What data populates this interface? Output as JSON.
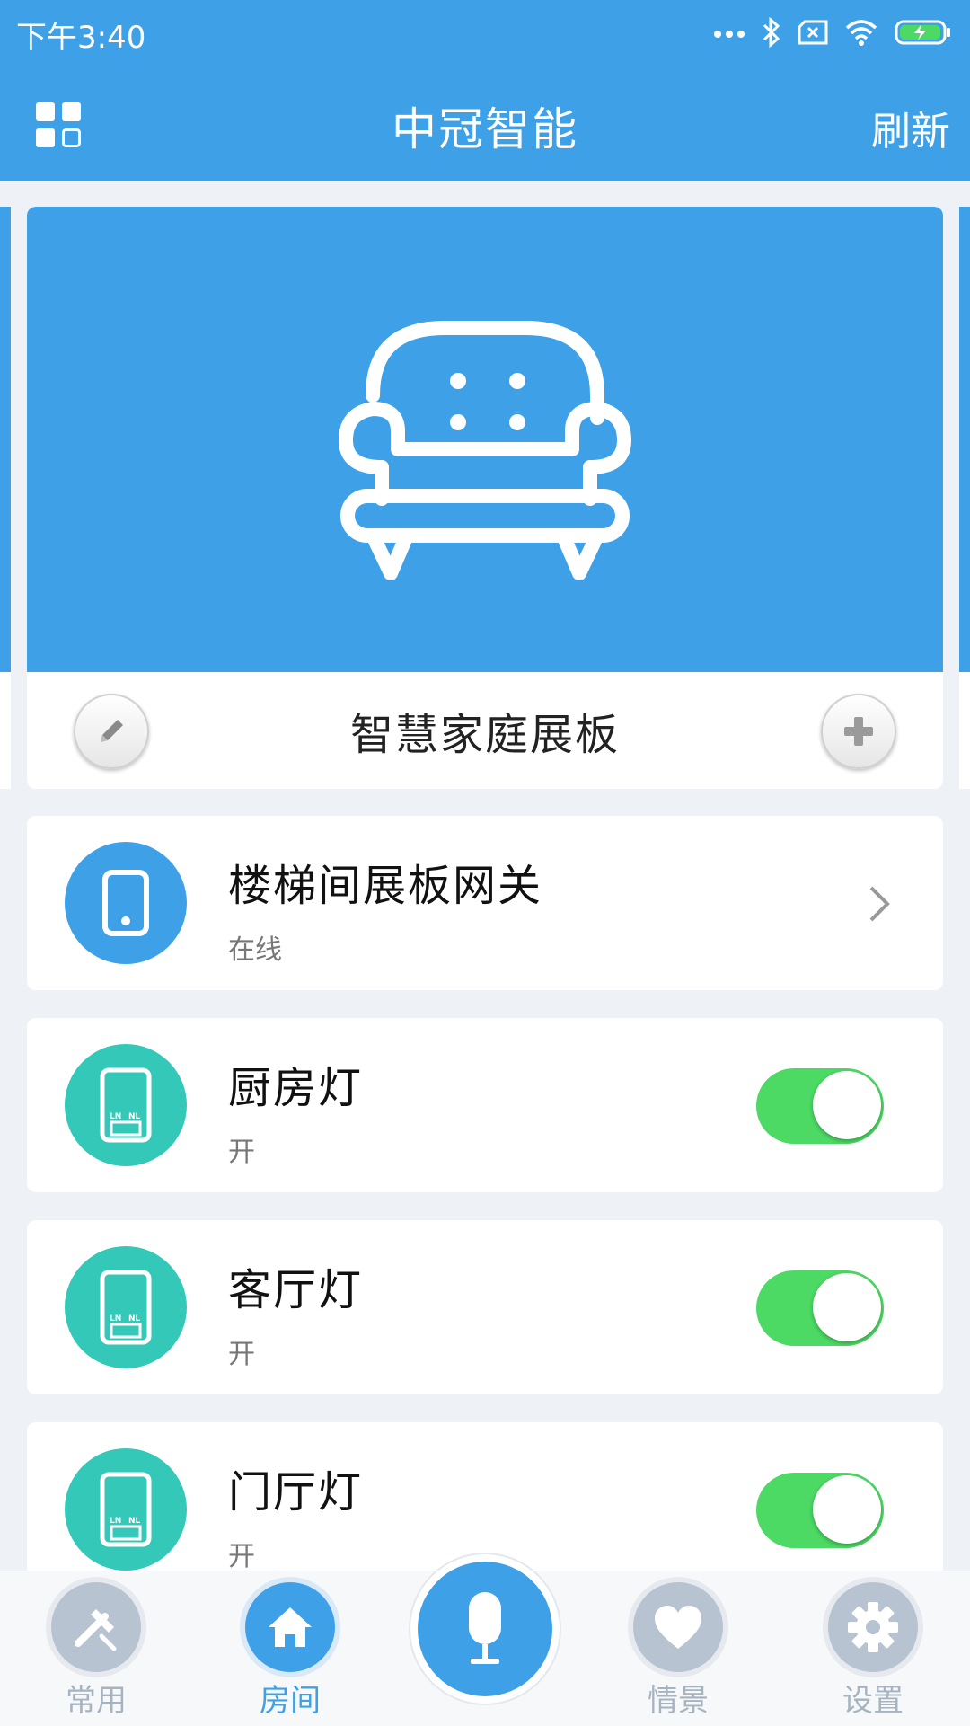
{
  "status_bar": {
    "time": "下午3:40",
    "battery_level": 0.9
  },
  "header": {
    "title": "中冠智能",
    "refresh_label": "刷新"
  },
  "room": {
    "name": "智慧家庭展板"
  },
  "devices": [
    {
      "name": "楼梯间展板网关",
      "status": "在线",
      "type": "gateway",
      "icon": "phone-icon",
      "has_toggle": false
    },
    {
      "name": "厨房灯",
      "status": "开",
      "type": "switch",
      "icon": "switch-panel-icon",
      "toggle_on": true
    },
    {
      "name": "客厅灯",
      "status": "开",
      "type": "switch",
      "icon": "switch-panel-icon",
      "toggle_on": true
    },
    {
      "name": "门厅灯",
      "status": "开",
      "type": "switch",
      "icon": "switch-panel-icon",
      "toggle_on": true
    }
  ],
  "switch_panel_text": {
    "left": "LN",
    "right": "NL"
  },
  "tabs": [
    {
      "label": "常用",
      "icon": "tools-icon",
      "active": false
    },
    {
      "label": "房间",
      "icon": "home-icon",
      "active": true
    },
    {
      "label": "情景",
      "icon": "heart-icon",
      "active": false
    },
    {
      "label": "设置",
      "icon": "gear-icon",
      "active": false
    }
  ],
  "colors": {
    "primary": "#3ea1e8",
    "teal": "#34c8b8",
    "toggle_on": "#4cd964",
    "inactive": "#b7c3d0"
  }
}
